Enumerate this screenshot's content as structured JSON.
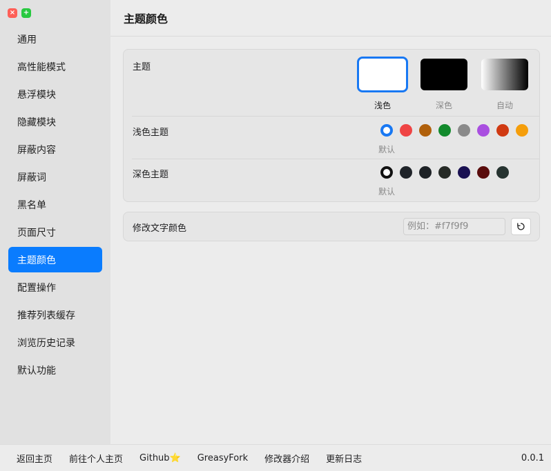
{
  "sidebar": {
    "items": [
      {
        "label": "通用"
      },
      {
        "label": "高性能模式"
      },
      {
        "label": "悬浮模块"
      },
      {
        "label": "隐藏模块"
      },
      {
        "label": "屏蔽内容"
      },
      {
        "label": "屏蔽词"
      },
      {
        "label": "黑名单"
      },
      {
        "label": "页面尺寸"
      },
      {
        "label": "主题颜色",
        "active": true
      },
      {
        "label": "配置操作"
      },
      {
        "label": "推荐列表缓存"
      },
      {
        "label": "浏览历史记录"
      },
      {
        "label": "默认功能"
      }
    ]
  },
  "header": {
    "title": "主题颜色"
  },
  "theme": {
    "label": "主题",
    "options": [
      {
        "caption": "浅色",
        "selected": true
      },
      {
        "caption": "深色"
      },
      {
        "caption": "自动"
      }
    ]
  },
  "light_theme": {
    "label": "浅色主题",
    "default_caption": "默认",
    "colors": [
      "#1878f3",
      "#ef4444",
      "#b0600b",
      "#128a2c",
      "#8a8a8a",
      "#a94fe0",
      "#d03a12",
      "#f59e0b"
    ]
  },
  "dark_theme": {
    "label": "深色主题",
    "default_caption": "默认",
    "colors": [
      "#111111",
      "#1f2329",
      "#1e2226",
      "#262a26",
      "#1a1152",
      "#5a0c0c",
      "#263330"
    ]
  },
  "text_color": {
    "label": "修改文字颜色",
    "placeholder": "例如：#f7f9f9",
    "reset_icon": "reset-icon"
  },
  "footer": {
    "links": [
      "返回主页",
      "前往个人主页",
      "Github⭐",
      "GreasyFork",
      "修改器介绍",
      "更新日志"
    ],
    "version": "0.0.1"
  }
}
